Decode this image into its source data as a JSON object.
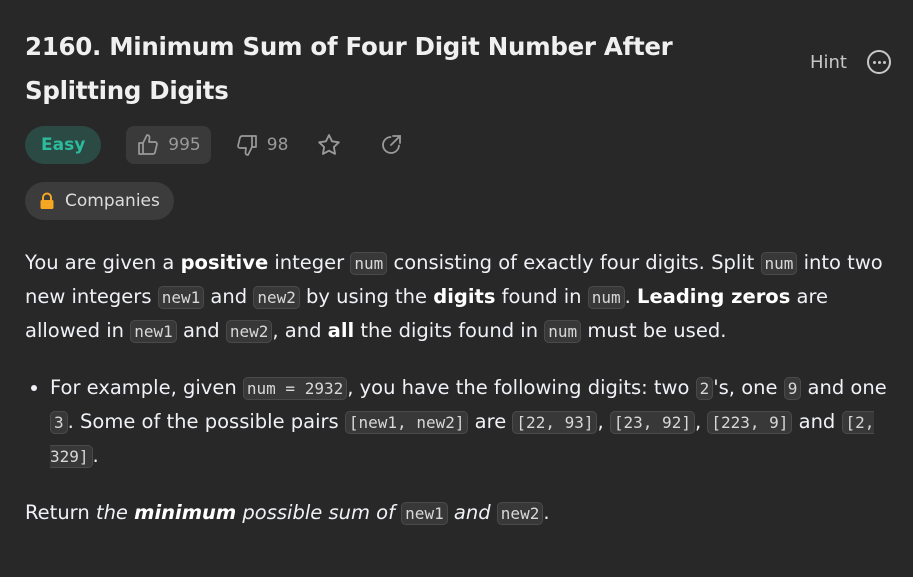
{
  "problem": {
    "title": "2160. Minimum Sum of Four Digit Number After Splitting Digits",
    "difficulty": "Easy",
    "likes": "995",
    "dislikes": "98",
    "hint_label": "Hint",
    "companies_label": "Companies"
  },
  "desc": {
    "p1": [
      "You are given a ",
      "positive",
      " integer ",
      "num",
      " consisting of exactly four digits. Split ",
      "num",
      " into two new integers ",
      "new1",
      " and ",
      "new2",
      " by using the ",
      "digits",
      " found in ",
      "num",
      ". ",
      "Leading zeros",
      " are allowed in ",
      "new1",
      " and ",
      "new2",
      ", and ",
      "all",
      " the digits found in ",
      "num",
      " must be used."
    ],
    "li1": [
      "For example, given ",
      "num = 2932",
      ", you have the following digits: two ",
      "2",
      "'s, one ",
      "9",
      " and one ",
      "3",
      ". Some of the possible pairs ",
      "[new1, new2]",
      " are ",
      "[22, 93]",
      ", ",
      "[23, 92]",
      ", ",
      "[223, 9]",
      " and ",
      "[2, 329]",
      "."
    ],
    "p2": [
      "Return ",
      "the ",
      "minimum",
      " possible sum of ",
      "new1",
      " and ",
      "new2",
      "."
    ]
  },
  "colors": {
    "background": "#282828",
    "easy": "#2cbb9d",
    "easy_bg": "#2a4a43",
    "text": "#eff1f6"
  },
  "icons": [
    "more-icon",
    "thumbs-up-icon",
    "thumbs-down-icon",
    "star-icon",
    "share-icon",
    "lock-icon"
  ]
}
